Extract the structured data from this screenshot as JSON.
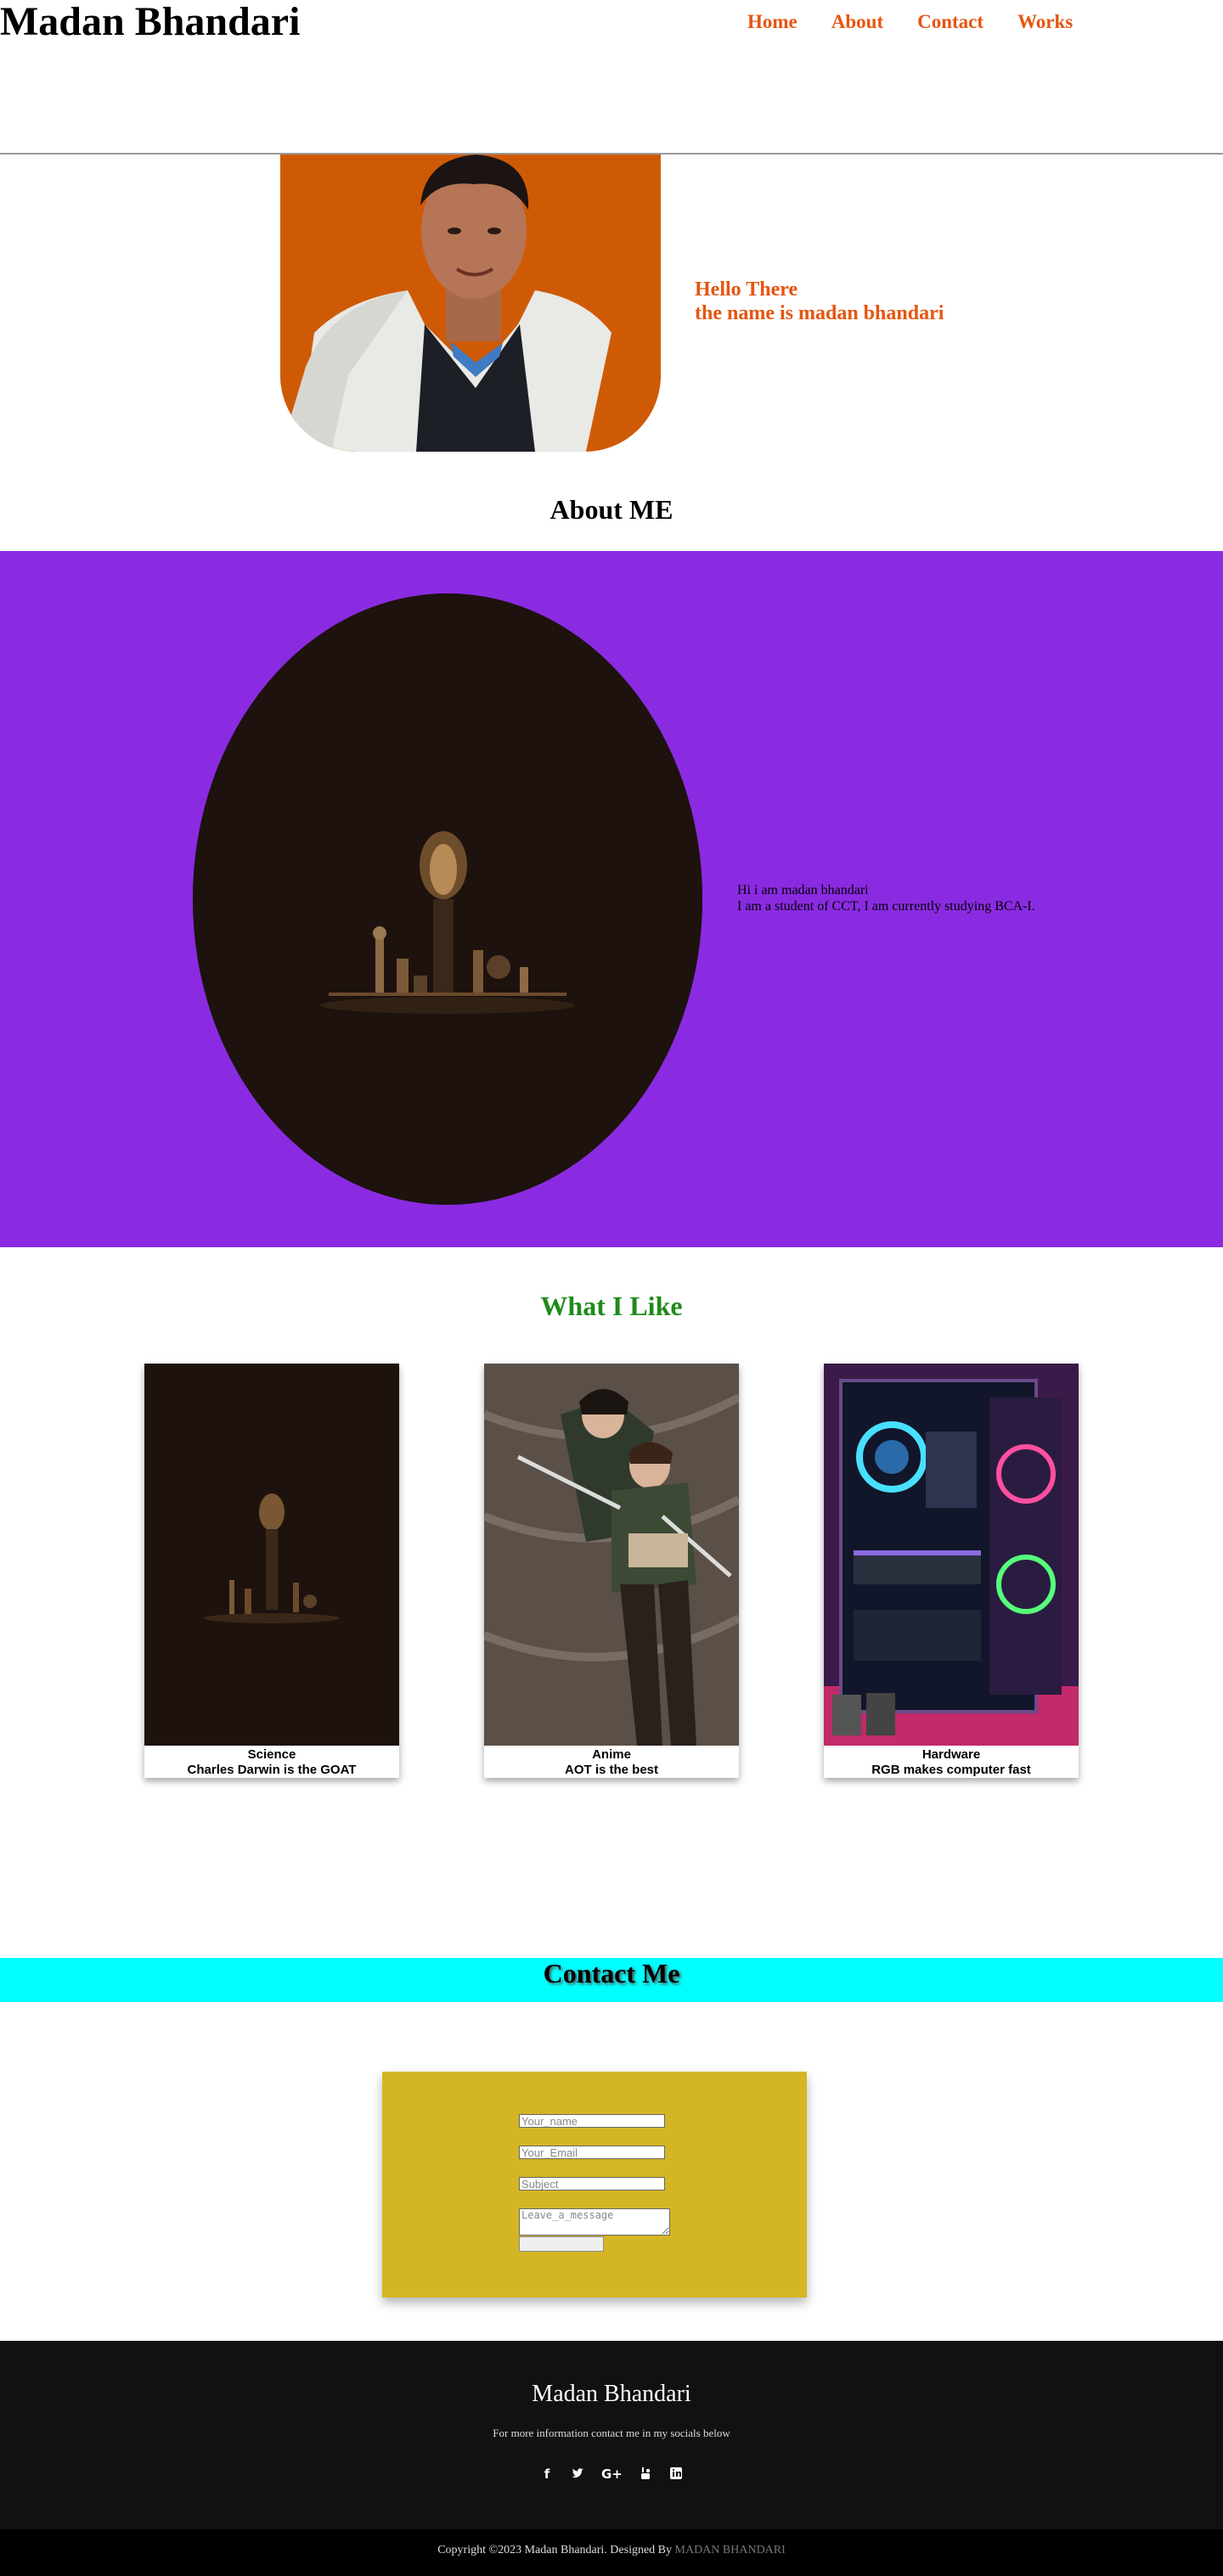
{
  "header": {
    "site_title": "Madan Bhandari",
    "nav": [
      "Home",
      "About",
      "Contact",
      "Works"
    ]
  },
  "hero": {
    "greeting": "Hello There",
    "name_line": "the name is madan bhandari",
    "photo_icon": "profile-photo"
  },
  "about": {
    "heading": "About ME",
    "line1": "Hi i am madan bhandari",
    "line2": "I am a student of CCT, I am currently studying BCA-I."
  },
  "likes": {
    "heading": "What I Like",
    "cards": [
      {
        "title": "Science",
        "subtitle": "Charles Darwin is the GOAT"
      },
      {
        "title": "Anime",
        "subtitle": "AOT is the best"
      },
      {
        "title": "Hardware",
        "subtitle": "RGB makes computer fast"
      }
    ]
  },
  "contact": {
    "heading": "Contact Me",
    "name_placeholder": "Your_name",
    "email_placeholder": "Your_Email",
    "subject_placeholder": "Subject",
    "message_placeholder": "Leave_a_message",
    "submit_label": ""
  },
  "footer": {
    "name": "Madan Bhandari",
    "note": "For more information contact me in my socials below",
    "socials": [
      "facebook-icon",
      "twitter-icon",
      "google-plus-icon",
      "youtube-icon",
      "linkedin-icon"
    ],
    "copyright_prefix": "Copyright ©2023 Madan Bhandari. Designed By",
    "designer": "MADAN BHANDARI"
  },
  "colors": {
    "accent_orange": "#e6550f",
    "about_band": "#8a2be2",
    "likes_heading": "#208a1b",
    "contact_band": "#00ffff",
    "form_bg": "#d4b624",
    "footer_bg": "#111111"
  }
}
